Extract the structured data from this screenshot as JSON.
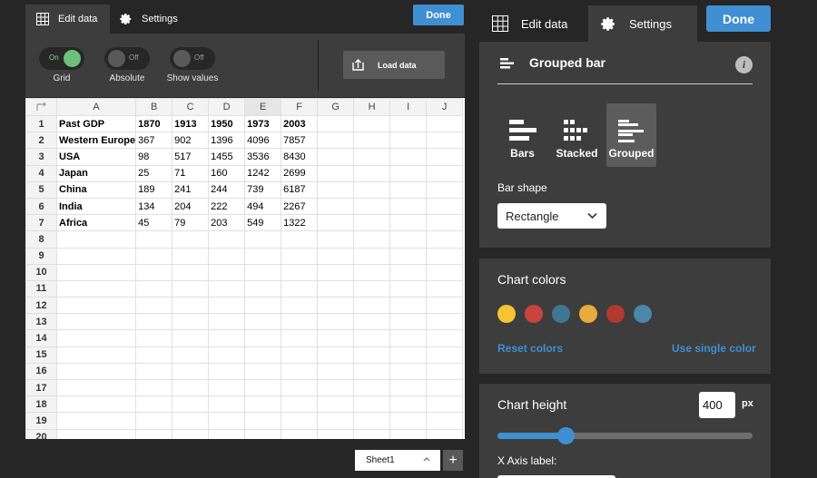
{
  "left_panel": {
    "tabs": [
      {
        "label": "Edit data",
        "icon": "table-icon",
        "active": true
      },
      {
        "label": "Settings",
        "icon": "gear-icon",
        "active": false
      }
    ],
    "done_label": "Done",
    "toolbar": {
      "toggles": [
        {
          "label": "Grid",
          "state_text": "On",
          "on": true
        },
        {
          "label": "Absolute",
          "state_text": "Off",
          "on": false
        },
        {
          "label": "Show values",
          "state_text": "Off",
          "on": false
        }
      ],
      "load_data_label": "Load data"
    },
    "sheet": {
      "columns": [
        "A",
        "B",
        "C",
        "D",
        "E",
        "F",
        "G",
        "H",
        "I",
        "J"
      ],
      "selected_column": "E",
      "row_count": 20,
      "rows": [
        [
          "Past GDP",
          "1870",
          "1913",
          "1950",
          "1973",
          "2003"
        ],
        [
          "Western Europe",
          "367",
          "902",
          "1396",
          "4096",
          "7857"
        ],
        [
          "USA",
          "98",
          "517",
          "1455",
          "3536",
          "8430"
        ],
        [
          "Japan",
          "25",
          "71",
          "160",
          "1242",
          "2699"
        ],
        [
          "China",
          "189",
          "241",
          "244",
          "739",
          "6187"
        ],
        [
          "India",
          "134",
          "204",
          "222",
          "494",
          "2267"
        ],
        [
          "Africa",
          "45",
          "79",
          "203",
          "549",
          "1322"
        ]
      ]
    },
    "sheet_tab": {
      "label": "Sheet1"
    },
    "add_sheet_label": "+"
  },
  "right_panel": {
    "tabs": [
      {
        "label": "Edit data",
        "icon": "table-icon",
        "active": false
      },
      {
        "label": "Settings",
        "icon": "gear-icon",
        "active": true
      }
    ],
    "done_label": "Done",
    "chart_type_card": {
      "title": "Grouped bar",
      "info_label": "i",
      "types": [
        {
          "label": "Bars",
          "active": false
        },
        {
          "label": "Stacked",
          "active": false
        },
        {
          "label": "Grouped",
          "active": true
        }
      ],
      "bar_shape_label": "Bar shape",
      "bar_shape_value": "Rectangle"
    },
    "colors_card": {
      "title": "Chart colors",
      "swatches": [
        "#f5c431",
        "#c9443c",
        "#3f7791",
        "#e8ab3c",
        "#b3382e",
        "#4a87aa"
      ],
      "reset_label": "Reset colors",
      "single_label": "Use single color"
    },
    "height_card": {
      "title": "Chart height",
      "height_value": "400",
      "unit": "px",
      "slider_fraction": 0.27,
      "x_axis_label": "X Axis label:"
    }
  }
}
